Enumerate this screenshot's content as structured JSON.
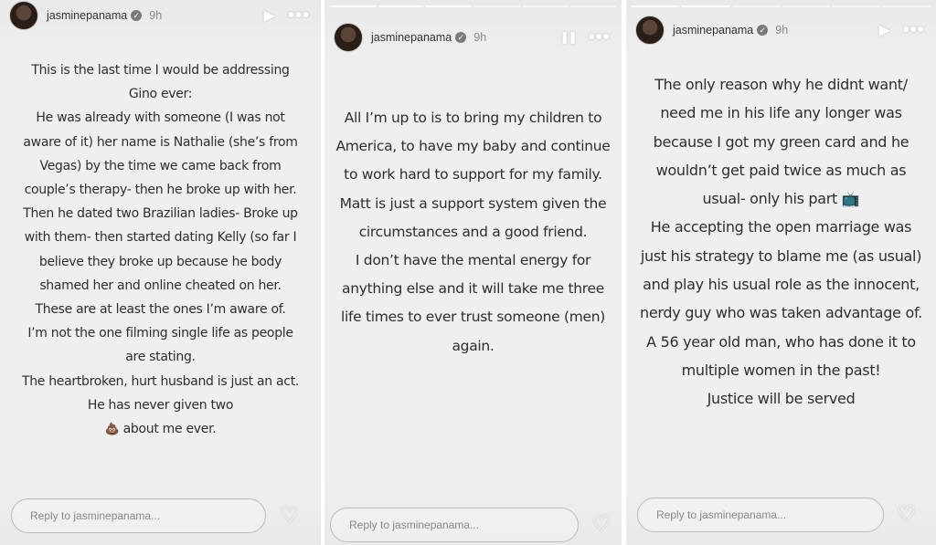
{
  "stories": [
    {
      "username": "jasminepanama",
      "time": "9h",
      "control_icon": "▶",
      "more_icon": "•••",
      "progress_total": 1,
      "progress_done": 0,
      "text": "This is the last time I would be addressing Gino ever:\nHe was already with someone (I was not aware of it) her name is Nathalie (she’s from Vegas) by the time we came back from couple’s therapy- then he broke up with her. Then he dated two Brazilian ladies- Broke up with them- then started dating Kelly (so far I believe they broke up because he body shamed her and online cheated on her.\nThese are at least the ones I’m aware of.\nI’m not the one filming single life as people are stating.\nThe heartbroken, hurt husband is just an act. He has never given two",
      "text_end_emoji": "💩",
      "text_end": " about me ever.",
      "reply_placeholder": "Reply to jasminepanama..."
    },
    {
      "username": "jasminepanama",
      "time": "9h",
      "control_icon": "❚❚",
      "more_icon": "•••",
      "progress_total": 6,
      "progress_done": 3,
      "text": "All I’m up to is to bring my children to America, to have my baby and continue to work hard to support for my family.\nMatt is just a support system given the circumstances and a good friend.\nI don’t have the mental energy for anything else and it will take me three life times to ever trust someone (men) again.",
      "reply_placeholder": "Reply to jasminepanama..."
    },
    {
      "username": "jasminepanama",
      "time": "9h",
      "control_icon": "▶",
      "more_icon": "•••",
      "progress_total": 6,
      "progress_done": 2,
      "text": "The only reason why he didnt want/ need me in his life any longer was because I got my green card and he wouldn’t get paid twice as much as usual- only his part 📺\nHe accepting the open marriage was just his strategy to blame me (as usual) and play his usual role as the innocent, nerdy guy who was taken advantage of.\nA 56 year old man, who has done it to multiple women in the past!\nJustice will be served",
      "reply_placeholder": "Reply to jasminepanama..."
    }
  ],
  "heart_icon": "♡",
  "verified_icon": "✓"
}
